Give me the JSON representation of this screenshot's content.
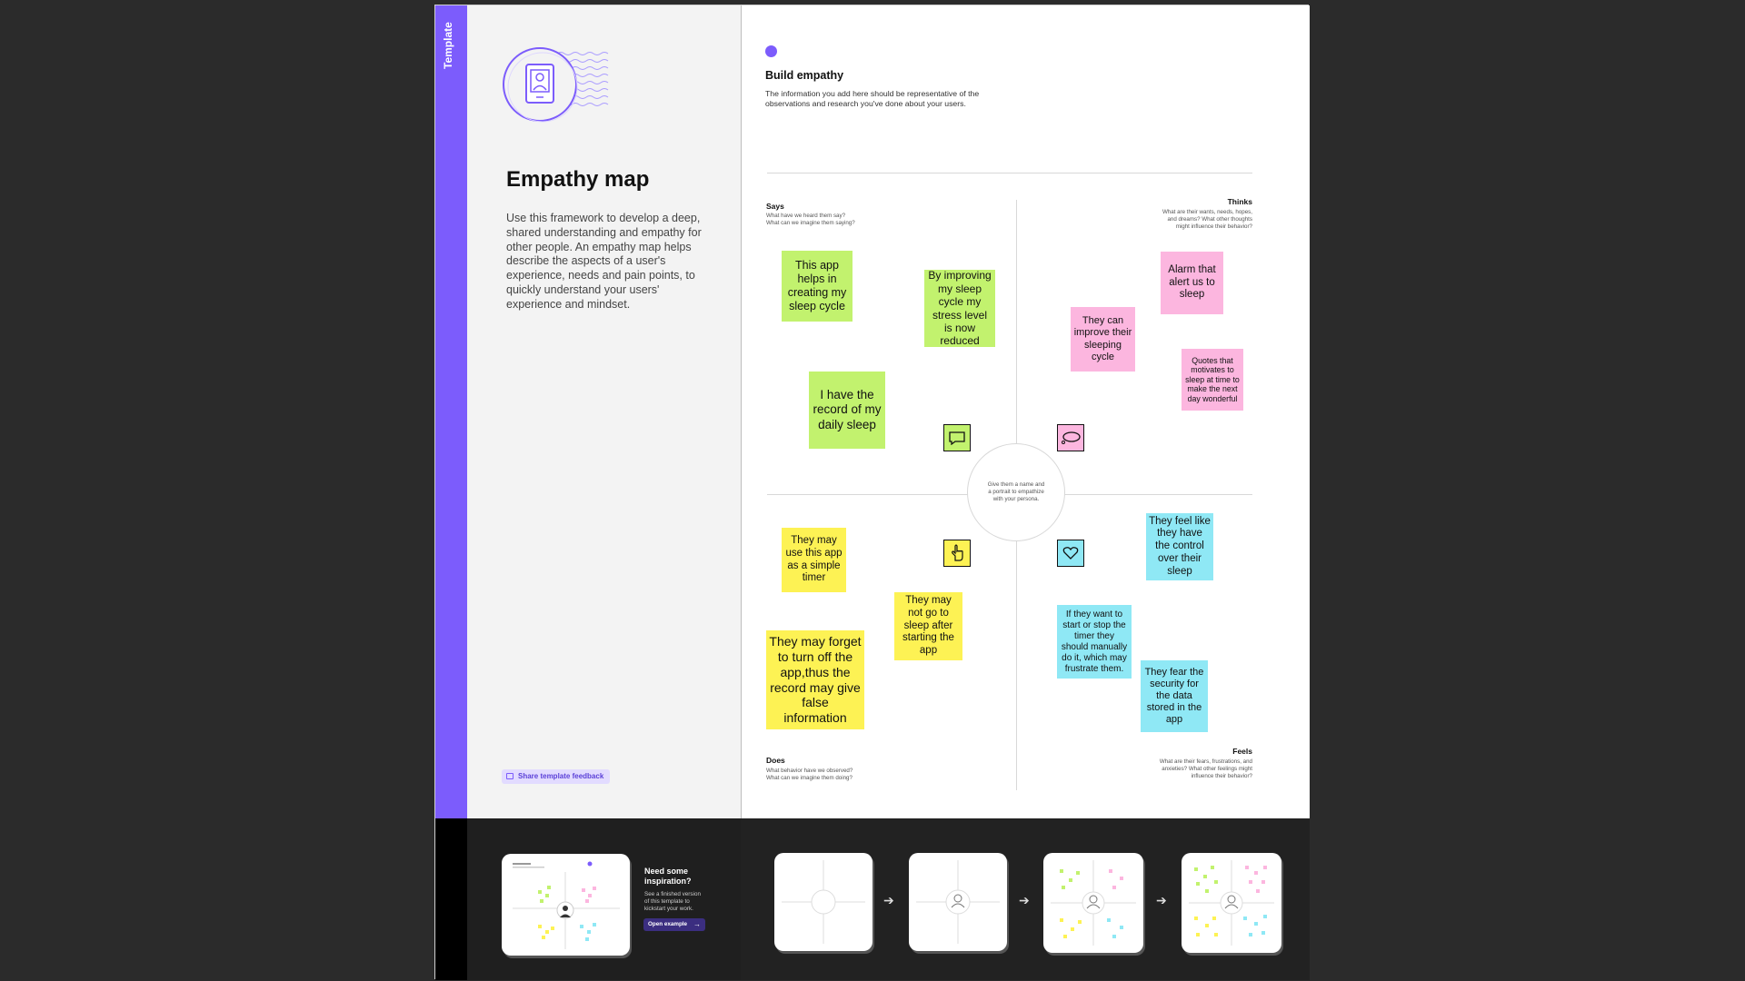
{
  "sidebar": {
    "tag": "Template",
    "title": "Empathy map",
    "description": "Use this framework to develop a deep, shared understanding and empathy for other people. An empathy map helps describe the aspects of a user's experience, needs and pain points, to quickly understand your users' experience and mindset.",
    "feedback_label": "Share template feedback"
  },
  "header": {
    "title": "Build empathy",
    "subtitle_line1": "The information you add here should be representative of the",
    "subtitle_line2": "observations and research you've done about your users."
  },
  "quadrants": {
    "says": {
      "label": "Says",
      "q1": "What have we heard them say?",
      "q2": "What can we imagine them saying?"
    },
    "thinks": {
      "label": "Thinks",
      "q1": "What are their wants, needs, hopes,",
      "q2": "and dreams? What other thoughts",
      "q3": "might influence their behavior?"
    },
    "does": {
      "label": "Does",
      "q1": "What behavior have we observed?",
      "q2": "What can we imagine them doing?"
    },
    "feels": {
      "label": "Feels",
      "q1": "What are their fears, frustrations, and",
      "q2": "anxieties? What other feelings might",
      "q3": "influence their behavior?"
    }
  },
  "persona_hint": {
    "l1": "Give them a name and",
    "l2": "a portrait to empathize",
    "l3": "with your persona."
  },
  "stickies": {
    "s1": "This app helps in creating my sleep cycle",
    "s2": "By improving my sleep cycle my stress level is now reduced",
    "s3": "I have the record of my daily sleep",
    "t1": "Alarm that alert us to sleep",
    "t2": "They can improve their sleeping cycle",
    "t3": "Quotes that motivates to sleep at time to make the next day wonderful",
    "d1": "They may use this app as a simple timer",
    "d2": "They may not go to sleep after starting the app",
    "d3": "They may forget to turn off the app,thus the record may give false information",
    "f1": "They feel like they have the control over their sleep",
    "f2": "If they want to start or stop the timer they should manually do it, which may frustrate them.",
    "f3": "They fear the security for the data stored in the app"
  },
  "inspiration": {
    "title_l1": "Need some",
    "title_l2": "inspiration?",
    "body_l1": "See a finished version",
    "body_l2": "of this template to",
    "body_l3": "kickstart your work.",
    "button": "Open example"
  },
  "colors": {
    "accent": "#7c5cfc",
    "green": "#c2f26e",
    "pink": "#fcb6df",
    "yellow": "#fdf254",
    "blue": "#8fe8f5"
  }
}
